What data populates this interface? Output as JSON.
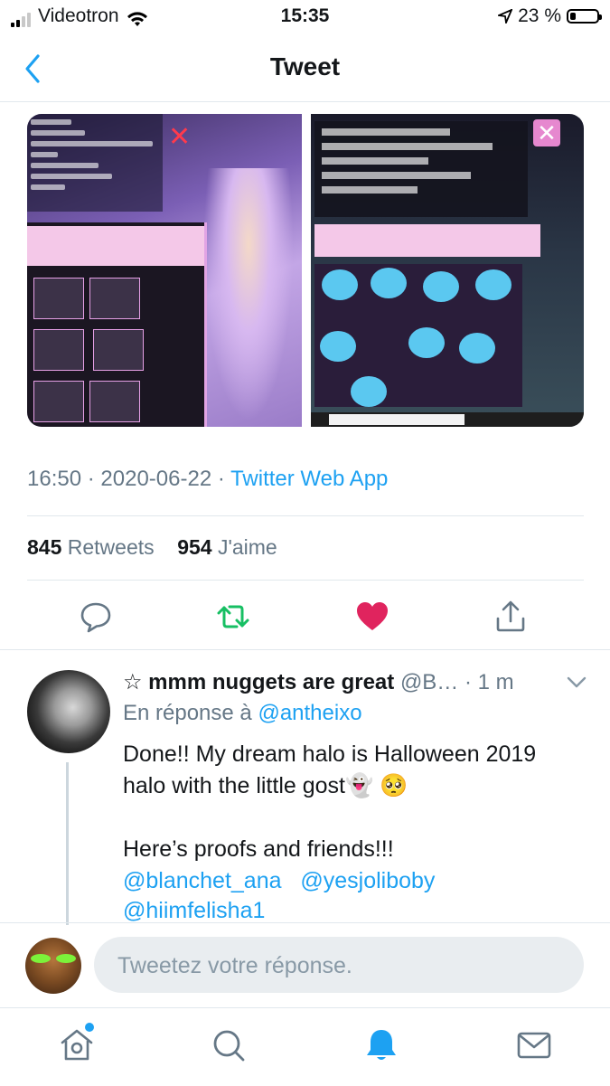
{
  "status_bar": {
    "carrier": "Videotron",
    "time": "15:35",
    "battery": "23 %",
    "battery_level": 0.23
  },
  "nav": {
    "title": "Tweet"
  },
  "tweet": {
    "time": "16:50",
    "date": "2020-06-22",
    "source": "Twitter Web App",
    "retweets_count": "845",
    "retweets_label": "Retweets",
    "likes_count": "954",
    "likes_label": "J'aime",
    "liked": true
  },
  "reply": {
    "name": "☆ mmm nuggets are great",
    "handle": "@B…",
    "time": "· 1 m",
    "in_reply_prefix": "En réponse à",
    "in_reply_handle": "@antheixo",
    "text_line1": "Done!! My dream halo is Halloween 2019",
    "text_line2": "halo with the little gost👻 🥺",
    "text_line3": "Here’s proofs and friends!!!",
    "mention1": "@blanchet_ana",
    "mention2": "@yesjoliboby",
    "mention3": "@hiimfelisha1"
  },
  "compose": {
    "placeholder": "Tweetez votre réponse."
  },
  "colors": {
    "accent": "#1da1f2",
    "like": "#e0245e",
    "retweet": "#17bf63",
    "muted": "#657786"
  },
  "icons": [
    "back-chevron-icon",
    "reply-icon",
    "retweet-icon",
    "heart-icon",
    "share-icon",
    "chevron-down-icon",
    "home-icon",
    "search-icon",
    "notifications-icon",
    "messages-icon"
  ]
}
